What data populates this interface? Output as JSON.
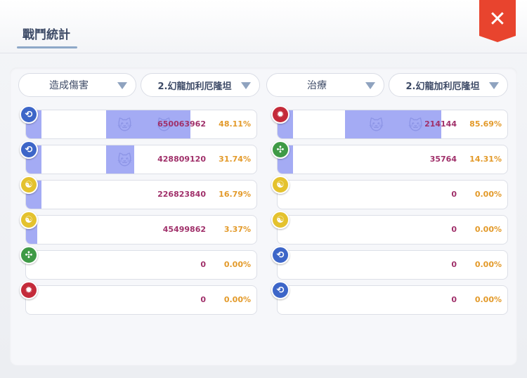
{
  "window": {
    "title": "戰鬥統計"
  },
  "close": {
    "icon": "close-icon",
    "glyph": "✕"
  },
  "left": {
    "metric": "造成傷害",
    "target": "2.幻龍加利厄隆坦",
    "rows": [
      {
        "icon": "blue",
        "symbol": "⟲",
        "value": "650063962",
        "percent": "48.11%",
        "fraction": 0.4811
      },
      {
        "icon": "blue",
        "symbol": "⟲",
        "value": "428809120",
        "percent": "31.74%",
        "fraction": 0.3174
      },
      {
        "icon": "yellow",
        "symbol": "☯",
        "value": "226823840",
        "percent": "16.79%",
        "fraction": 0.1679
      },
      {
        "icon": "yellow",
        "symbol": "☯",
        "value": "45499862",
        "percent": "3.37%",
        "fraction": 0.0337
      },
      {
        "icon": "green",
        "symbol": "✣",
        "value": "0",
        "percent": "0.00%",
        "fraction": 0
      },
      {
        "icon": "red",
        "symbol": "✹",
        "value": "0",
        "percent": "0.00%",
        "fraction": 0
      }
    ]
  },
  "right": {
    "metric": "治療",
    "target": "2.幻龍加利厄隆坦",
    "rows": [
      {
        "icon": "red",
        "symbol": "✹",
        "value": "214144",
        "percent": "85.69%",
        "fraction": 0.8569
      },
      {
        "icon": "green",
        "symbol": "✣",
        "value": "35764",
        "percent": "14.31%",
        "fraction": 0.1431
      },
      {
        "icon": "yellow",
        "symbol": "☯",
        "value": "0",
        "percent": "0.00%",
        "fraction": 0
      },
      {
        "icon": "yellow",
        "symbol": "☯",
        "value": "0",
        "percent": "0.00%",
        "fraction": 0
      },
      {
        "icon": "blue",
        "symbol": "⟲",
        "value": "0",
        "percent": "0.00%",
        "fraction": 0
      },
      {
        "icon": "blue",
        "symbol": "⟲",
        "value": "0",
        "percent": "0.00%",
        "fraction": 0
      }
    ]
  },
  "colors": {
    "bar": "#a4abf4",
    "value": "#a0306a",
    "percent": "#e39a2a",
    "close": "#e8442e"
  }
}
